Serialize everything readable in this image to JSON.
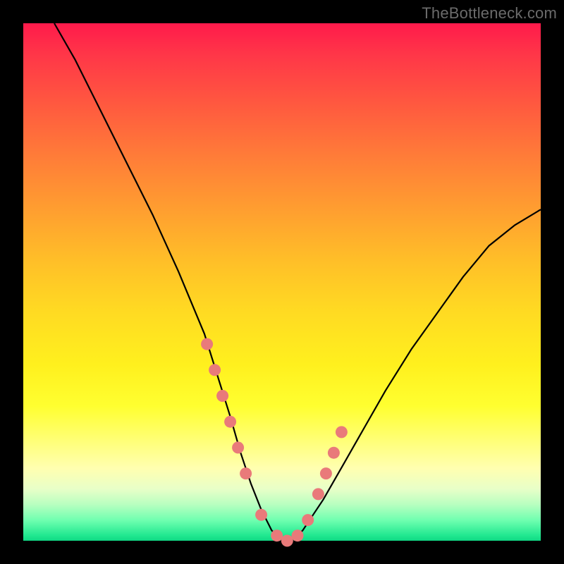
{
  "watermark": "TheBottleneck.com",
  "chart_data": {
    "type": "line",
    "title": "",
    "xlabel": "",
    "ylabel": "",
    "xlim": [
      0,
      100
    ],
    "ylim": [
      0,
      100
    ],
    "grid": false,
    "background_gradient": [
      "#ff1a4b",
      "#ffff30",
      "#10d884"
    ],
    "series": [
      {
        "name": "bottleneck-curve",
        "x": [
          6,
          10,
          15,
          20,
          25,
          30,
          35,
          40,
          42,
          44,
          46,
          48,
          50,
          52,
          54,
          58,
          62,
          66,
          70,
          75,
          80,
          85,
          90,
          95,
          100
        ],
        "y": [
          100,
          93,
          83,
          73,
          63,
          52,
          40,
          24,
          17,
          11,
          6,
          2,
          0,
          0,
          2,
          8,
          15,
          22,
          29,
          37,
          44,
          51,
          57,
          61,
          64
        ]
      }
    ],
    "markers": {
      "name": "highlight-points",
      "color": "#e97a7a",
      "x": [
        35.5,
        37,
        38.5,
        40,
        41.5,
        43,
        46,
        49,
        51,
        53,
        55,
        57,
        58.5,
        60,
        61.5
      ],
      "y": [
        38,
        33,
        28,
        23,
        18,
        13,
        5,
        1,
        0,
        1,
        4,
        9,
        13,
        17,
        21
      ]
    }
  }
}
